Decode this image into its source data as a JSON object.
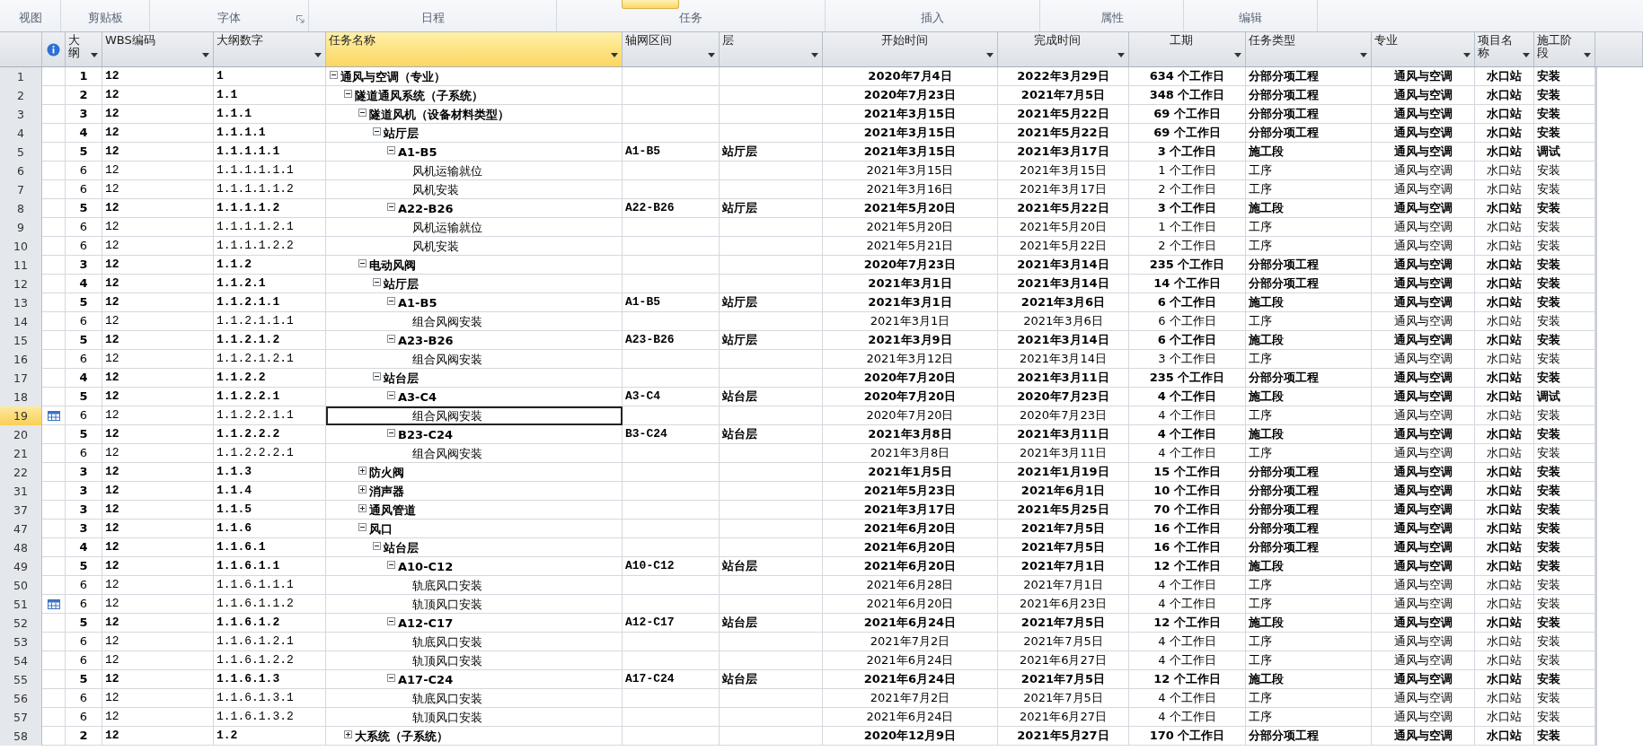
{
  "ribbon_groups": [
    {
      "label": "视图",
      "dialog_launcher": false,
      "highlighted_button": false
    },
    {
      "label": "剪贴板",
      "dialog_launcher": false,
      "highlighted_button": false
    },
    {
      "label": "字体",
      "dialog_launcher": true,
      "highlighted_button": false
    },
    {
      "label": "日程",
      "dialog_launcher": false,
      "highlighted_button": false
    },
    {
      "label": "任务",
      "dialog_launcher": false,
      "highlighted_button": true
    },
    {
      "label": "插入",
      "dialog_launcher": false,
      "highlighted_button": false
    },
    {
      "label": "属性",
      "dialog_launcher": false,
      "highlighted_button": false
    },
    {
      "label": "编辑",
      "dialog_launcher": false,
      "highlighted_button": false
    }
  ],
  "columns": [
    {
      "label": "大纲",
      "selected": false
    },
    {
      "label": "WBS编码",
      "selected": false
    },
    {
      "label": "大纲数字",
      "selected": false
    },
    {
      "label": "任务名称",
      "selected": true
    },
    {
      "label": "轴网区间",
      "selected": false
    },
    {
      "label": "层",
      "selected": false
    },
    {
      "label": "开始时间",
      "selected": false
    },
    {
      "label": "完成时间",
      "selected": false
    },
    {
      "label": "工期",
      "selected": false
    },
    {
      "label": "任务类型",
      "selected": false
    },
    {
      "label": "专业",
      "selected": false
    },
    {
      "label": "项目名称",
      "selected": false
    },
    {
      "label": "施工阶段",
      "selected": false
    }
  ],
  "tasks": [
    {
      "id": "1",
      "level": "1",
      "wbs": "12",
      "outline": "1",
      "name": "通风与空调（专业）",
      "start": "2020年7月4日",
      "finish": "2022年3月29日",
      "duration": "634 个工作日",
      "type": "分部分项工程",
      "discipline": "通风与空调",
      "project": "水口站",
      "stage": "安装",
      "summary": true,
      "expanded": true,
      "indicator": false,
      "selected": false,
      "children": [
        {
          "id": "2",
          "level": "2",
          "wbs": "12",
          "outline": "1.1",
          "name": "隧道通风系统（子系统）",
          "start": "2020年7月23日",
          "finish": "2021年7月5日",
          "duration": "348 个工作日",
          "type": "分部分项工程",
          "discipline": "通风与空调",
          "project": "水口站",
          "stage": "安装",
          "summary": true,
          "expanded": true,
          "indicator": false,
          "selected": false,
          "children": [
            {
              "id": "3",
              "level": "3",
              "wbs": "12",
              "outline": "1.1.1",
              "name": "隧道风机（设备材料类型）",
              "start": "2021年3月15日",
              "finish": "2021年5月22日",
              "duration": "69 个工作日",
              "type": "分部分项工程",
              "discipline": "通风与空调",
              "project": "水口站",
              "stage": "安装",
              "summary": true,
              "expanded": true,
              "indicator": false,
              "selected": false,
              "children": [
                {
                  "id": "4",
                  "level": "4",
                  "wbs": "12",
                  "outline": "1.1.1.1",
                  "name": "站厅层",
                  "start": "2021年3月15日",
                  "finish": "2021年5月22日",
                  "duration": "69 个工作日",
                  "type": "分部分项工程",
                  "discipline": "通风与空调",
                  "project": "水口站",
                  "stage": "安装",
                  "summary": true,
                  "expanded": true,
                  "indicator": false,
                  "selected": false,
                  "children": [
                    {
                      "id": "5",
                      "level": "5",
                      "wbs": "12",
                      "outline": "1.1.1.1.1",
                      "name": "A1-B5",
                      "axis": "A1-B5",
                      "floor": "站厅层",
                      "start": "2021年3月15日",
                      "finish": "2021年3月17日",
                      "duration": "3 个工作日",
                      "type": "施工段",
                      "discipline": "通风与空调",
                      "project": "水口站",
                      "stage": "调试",
                      "summary": true,
                      "expanded": true,
                      "indicator": false,
                      "selected": false,
                      "children": [
                        {
                          "id": "6",
                          "level": "6",
                          "wbs": "12",
                          "outline": "1.1.1.1.1.1",
                          "name": "风机运输就位",
                          "start": "2021年3月15日",
                          "finish": "2021年3月15日",
                          "duration": "1 个工作日",
                          "type": "工序",
                          "discipline": "通风与空调",
                          "project": "水口站",
                          "stage": "安装",
                          "summary": false,
                          "indicator": false,
                          "selected": false
                        },
                        {
                          "id": "7",
                          "level": "6",
                          "wbs": "12",
                          "outline": "1.1.1.1.1.2",
                          "name": "风机安装",
                          "start": "2021年3月16日",
                          "finish": "2021年3月17日",
                          "duration": "2 个工作日",
                          "type": "工序",
                          "discipline": "通风与空调",
                          "project": "水口站",
                          "stage": "安装",
                          "summary": false,
                          "indicator": false,
                          "selected": false
                        }
                      ]
                    },
                    {
                      "id": "8",
                      "level": "5",
                      "wbs": "12",
                      "outline": "1.1.1.1.2",
                      "name": "A22-B26",
                      "axis": "A22-B26",
                      "floor": "站厅层",
                      "start": "2021年5月20日",
                      "finish": "2021年5月22日",
                      "duration": "3 个工作日",
                      "type": "施工段",
                      "discipline": "通风与空调",
                      "project": "水口站",
                      "stage": "安装",
                      "summary": true,
                      "expanded": true,
                      "indicator": false,
                      "selected": false,
                      "children": [
                        {
                          "id": "9",
                          "level": "6",
                          "wbs": "12",
                          "outline": "1.1.1.1.2.1",
                          "name": "风机运输就位",
                          "start": "2021年5月20日",
                          "finish": "2021年5月20日",
                          "duration": "1 个工作日",
                          "type": "工序",
                          "discipline": "通风与空调",
                          "project": "水口站",
                          "stage": "安装",
                          "summary": false,
                          "indicator": false,
                          "selected": false
                        },
                        {
                          "id": "10",
                          "level": "6",
                          "wbs": "12",
                          "outline": "1.1.1.1.2.2",
                          "name": "风机安装",
                          "start": "2021年5月21日",
                          "finish": "2021年5月22日",
                          "duration": "2 个工作日",
                          "type": "工序",
                          "discipline": "通风与空调",
                          "project": "水口站",
                          "stage": "安装",
                          "summary": false,
                          "indicator": false,
                          "selected": false
                        }
                      ]
                    }
                  ]
                }
              ]
            },
            {
              "id": "11",
              "level": "3",
              "wbs": "12",
              "outline": "1.1.2",
              "name": "电动风阀",
              "start": "2020年7月23日",
              "finish": "2021年3月14日",
              "duration": "235 个工作日",
              "type": "分部分项工程",
              "discipline": "通风与空调",
              "project": "水口站",
              "stage": "安装",
              "summary": true,
              "expanded": true,
              "indicator": false,
              "selected": false,
              "children": [
                {
                  "id": "12",
                  "level": "4",
                  "wbs": "12",
                  "outline": "1.1.2.1",
                  "name": "站厅层",
                  "start": "2021年3月1日",
                  "finish": "2021年3月14日",
                  "duration": "14 个工作日",
                  "type": "分部分项工程",
                  "discipline": "通风与空调",
                  "project": "水口站",
                  "stage": "安装",
                  "summary": true,
                  "expanded": true,
                  "indicator": false,
                  "selected": false,
                  "children": [
                    {
                      "id": "13",
                      "level": "5",
                      "wbs": "12",
                      "outline": "1.1.2.1.1",
                      "name": "A1-B5",
                      "axis": "A1-B5",
                      "floor": "站厅层",
                      "start": "2021年3月1日",
                      "finish": "2021年3月6日",
                      "duration": "6 个工作日",
                      "type": "施工段",
                      "discipline": "通风与空调",
                      "project": "水口站",
                      "stage": "安装",
                      "summary": true,
                      "expanded": true,
                      "indicator": false,
                      "selected": false,
                      "children": [
                        {
                          "id": "14",
                          "level": "6",
                          "wbs": "12",
                          "outline": "1.1.2.1.1.1",
                          "name": "组合风阀安装",
                          "start": "2021年3月1日",
                          "finish": "2021年3月6日",
                          "duration": "6 个工作日",
                          "type": "工序",
                          "discipline": "通风与空调",
                          "project": "水口站",
                          "stage": "安装",
                          "summary": false,
                          "indicator": false,
                          "selected": false
                        }
                      ]
                    },
                    {
                      "id": "15",
                      "level": "5",
                      "wbs": "12",
                      "outline": "1.1.2.1.2",
                      "name": "A23-B26",
                      "axis": "A23-B26",
                      "floor": "站厅层",
                      "start": "2021年3月9日",
                      "finish": "2021年3月14日",
                      "duration": "6 个工作日",
                      "type": "施工段",
                      "discipline": "通风与空调",
                      "project": "水口站",
                      "stage": "安装",
                      "summary": true,
                      "expanded": true,
                      "indicator": false,
                      "selected": false,
                      "children": [
                        {
                          "id": "16",
                          "level": "6",
                          "wbs": "12",
                          "outline": "1.1.2.1.2.1",
                          "name": "组合风阀安装",
                          "start": "2021年3月12日",
                          "finish": "2021年3月14日",
                          "duration": "3 个工作日",
                          "type": "工序",
                          "discipline": "通风与空调",
                          "project": "水口站",
                          "stage": "安装",
                          "summary": false,
                          "indicator": false,
                          "selected": false
                        }
                      ]
                    }
                  ]
                },
                {
                  "id": "17",
                  "level": "4",
                  "wbs": "12",
                  "outline": "1.1.2.2",
                  "name": "站台层",
                  "start": "2020年7月20日",
                  "finish": "2021年3月11日",
                  "duration": "235 个工作日",
                  "type": "分部分项工程",
                  "discipline": "通风与空调",
                  "project": "水口站",
                  "stage": "安装",
                  "summary": true,
                  "expanded": true,
                  "indicator": false,
                  "selected": false,
                  "children": [
                    {
                      "id": "18",
                      "level": "5",
                      "wbs": "12",
                      "outline": "1.1.2.2.1",
                      "name": "A3-C4",
                      "axis": "A3-C4",
                      "floor": "站台层",
                      "start": "2020年7月20日",
                      "finish": "2020年7月23日",
                      "duration": "4 个工作日",
                      "type": "施工段",
                      "discipline": "通风与空调",
                      "project": "水口站",
                      "stage": "调试",
                      "summary": true,
                      "expanded": true,
                      "indicator": false,
                      "selected": false,
                      "children": [
                        {
                          "id": "19",
                          "level": "6",
                          "wbs": "12",
                          "outline": "1.1.2.2.1.1",
                          "name": "组合风阀安装",
                          "start": "2020年7月20日",
                          "finish": "2020年7月23日",
                          "duration": "4 个工作日",
                          "type": "工序",
                          "discipline": "通风与空调",
                          "project": "水口站",
                          "stage": "安装",
                          "summary": false,
                          "indicator": true,
                          "selected": true
                        }
                      ]
                    },
                    {
                      "id": "20",
                      "level": "5",
                      "wbs": "12",
                      "outline": "1.1.2.2.2",
                      "name": "B23-C24",
                      "axis": "B3-C24",
                      "floor": "站台层",
                      "start": "2021年3月8日",
                      "finish": "2021年3月11日",
                      "duration": "4 个工作日",
                      "type": "施工段",
                      "discipline": "通风与空调",
                      "project": "水口站",
                      "stage": "安装",
                      "summary": true,
                      "expanded": true,
                      "indicator": false,
                      "selected": false,
                      "children": [
                        {
                          "id": "21",
                          "level": "6",
                          "wbs": "12",
                          "outline": "1.1.2.2.2.1",
                          "name": "组合风阀安装",
                          "start": "2021年3月8日",
                          "finish": "2021年3月11日",
                          "duration": "4 个工作日",
                          "type": "工序",
                          "discipline": "通风与空调",
                          "project": "水口站",
                          "stage": "安装",
                          "summary": false,
                          "indicator": false,
                          "selected": false
                        }
                      ]
                    }
                  ]
                }
              ]
            },
            {
              "id": "22",
              "level": "3",
              "wbs": "12",
              "outline": "1.1.3",
              "name": "防火阀",
              "start": "2021年1月5日",
              "finish": "2021年1月19日",
              "duration": "15 个工作日",
              "type": "分部分项工程",
              "discipline": "通风与空调",
              "project": "水口站",
              "stage": "安装",
              "summary": true,
              "expanded": false,
              "indicator": false,
              "selected": false
            },
            {
              "id": "31",
              "level": "3",
              "wbs": "12",
              "outline": "1.1.4",
              "name": "消声器",
              "start": "2021年5月23日",
              "finish": "2021年6月1日",
              "duration": "10 个工作日",
              "type": "分部分项工程",
              "discipline": "通风与空调",
              "project": "水口站",
              "stage": "安装",
              "summary": true,
              "expanded": false,
              "indicator": false,
              "selected": false
            },
            {
              "id": "37",
              "level": "3",
              "wbs": "12",
              "outline": "1.1.5",
              "name": "通风管道",
              "start": "2021年3月17日",
              "finish": "2021年5月25日",
              "duration": "70 个工作日",
              "type": "分部分项工程",
              "discipline": "通风与空调",
              "project": "水口站",
              "stage": "安装",
              "summary": true,
              "expanded": false,
              "indicator": false,
              "selected": false
            },
            {
              "id": "47",
              "level": "3",
              "wbs": "12",
              "outline": "1.1.6",
              "name": "风口",
              "start": "2021年6月20日",
              "finish": "2021年7月5日",
              "duration": "16 个工作日",
              "type": "分部分项工程",
              "discipline": "通风与空调",
              "project": "水口站",
              "stage": "安装",
              "summary": true,
              "expanded": true,
              "indicator": false,
              "selected": false,
              "children": [
                {
                  "id": "48",
                  "level": "4",
                  "wbs": "12",
                  "outline": "1.1.6.1",
                  "name": "站台层",
                  "start": "2021年6月20日",
                  "finish": "2021年7月5日",
                  "duration": "16 个工作日",
                  "type": "分部分项工程",
                  "discipline": "通风与空调",
                  "project": "水口站",
                  "stage": "安装",
                  "summary": true,
                  "expanded": true,
                  "indicator": false,
                  "selected": false,
                  "children": [
                    {
                      "id": "49",
                      "level": "5",
                      "wbs": "12",
                      "outline": "1.1.6.1.1",
                      "name": "A10-C12",
                      "axis": "A10-C12",
                      "floor": "站台层",
                      "start": "2021年6月20日",
                      "finish": "2021年7月1日",
                      "duration": "12 个工作日",
                      "type": "施工段",
                      "discipline": "通风与空调",
                      "project": "水口站",
                      "stage": "安装",
                      "summary": true,
                      "expanded": true,
                      "indicator": false,
                      "selected": false,
                      "children": [
                        {
                          "id": "50",
                          "level": "6",
                          "wbs": "12",
                          "outline": "1.1.6.1.1.1",
                          "name": "轨底风口安装",
                          "start": "2021年6月28日",
                          "finish": "2021年7月1日",
                          "duration": "4 个工作日",
                          "type": "工序",
                          "discipline": "通风与空调",
                          "project": "水口站",
                          "stage": "安装",
                          "summary": false,
                          "indicator": false,
                          "selected": false
                        },
                        {
                          "id": "51",
                          "level": "6",
                          "wbs": "12",
                          "outline": "1.1.6.1.1.2",
                          "name": "轨顶风口安装",
                          "start": "2021年6月20日",
                          "finish": "2021年6月23日",
                          "duration": "4 个工作日",
                          "type": "工序",
                          "discipline": "通风与空调",
                          "project": "水口站",
                          "stage": "安装",
                          "summary": false,
                          "indicator": true,
                          "selected": false
                        }
                      ]
                    },
                    {
                      "id": "52",
                      "level": "5",
                      "wbs": "12",
                      "outline": "1.1.6.1.2",
                      "name": "A12-C17",
                      "axis": "A12-C17",
                      "floor": "站台层",
                      "start": "2021年6月24日",
                      "finish": "2021年7月5日",
                      "duration": "12 个工作日",
                      "type": "施工段",
                      "discipline": "通风与空调",
                      "project": "水口站",
                      "stage": "安装",
                      "summary": true,
                      "expanded": true,
                      "indicator": false,
                      "selected": false,
                      "children": [
                        {
                          "id": "53",
                          "level": "6",
                          "wbs": "12",
                          "outline": "1.1.6.1.2.1",
                          "name": "轨底风口安装",
                          "start": "2021年7月2日",
                          "finish": "2021年7月5日",
                          "duration": "4 个工作日",
                          "type": "工序",
                          "discipline": "通风与空调",
                          "project": "水口站",
                          "stage": "安装",
                          "summary": false,
                          "indicator": false,
                          "selected": false
                        },
                        {
                          "id": "54",
                          "level": "6",
                          "wbs": "12",
                          "outline": "1.1.6.1.2.2",
                          "name": "轨顶风口安装",
                          "start": "2021年6月24日",
                          "finish": "2021年6月27日",
                          "duration": "4 个工作日",
                          "type": "工序",
                          "discipline": "通风与空调",
                          "project": "水口站",
                          "stage": "安装",
                          "summary": false,
                          "indicator": false,
                          "selected": false
                        }
                      ]
                    },
                    {
                      "id": "55",
                      "level": "5",
                      "wbs": "12",
                      "outline": "1.1.6.1.3",
                      "name": "A17-C24",
                      "axis": "A17-C24",
                      "floor": "站台层",
                      "start": "2021年6月24日",
                      "finish": "2021年7月5日",
                      "duration": "12 个工作日",
                      "type": "施工段",
                      "discipline": "通风与空调",
                      "project": "水口站",
                      "stage": "安装",
                      "summary": true,
                      "expanded": true,
                      "indicator": false,
                      "selected": false,
                      "children": [
                        {
                          "id": "56",
                          "level": "6",
                          "wbs": "12",
                          "outline": "1.1.6.1.3.1",
                          "name": "轨底风口安装",
                          "start": "2021年7月2日",
                          "finish": "2021年7月5日",
                          "duration": "4 个工作日",
                          "type": "工序",
                          "discipline": "通风与空调",
                          "project": "水口站",
                          "stage": "安装",
                          "summary": false,
                          "indicator": false,
                          "selected": false
                        },
                        {
                          "id": "57",
                          "level": "6",
                          "wbs": "12",
                          "outline": "1.1.6.1.3.2",
                          "name": "轨顶风口安装",
                          "start": "2021年6月24日",
                          "finish": "2021年6月27日",
                          "duration": "4 个工作日",
                          "type": "工序",
                          "discipline": "通风与空调",
                          "project": "水口站",
                          "stage": "安装",
                          "summary": false,
                          "indicator": false,
                          "selected": false
                        }
                      ]
                    }
                  ]
                }
              ]
            }
          ]
        },
        {
          "id": "58",
          "level": "2",
          "wbs": "12",
          "outline": "1.2",
          "name": "大系统（子系统）",
          "start": "2020年12月9日",
          "finish": "2021年5月27日",
          "duration": "170 个工作日",
          "type": "分部分项工程",
          "discipline": "通风与空调",
          "project": "水口站",
          "stage": "安装",
          "summary": true,
          "expanded": false,
          "indicator": false,
          "selected": false
        }
      ]
    }
  ]
}
